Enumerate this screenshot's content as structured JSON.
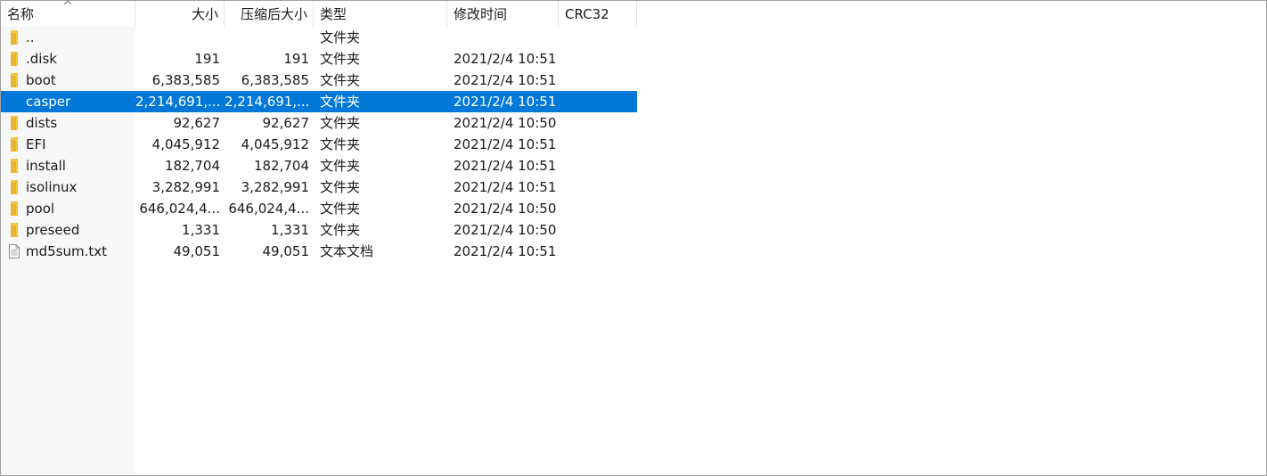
{
  "columns": {
    "name": "名称",
    "size": "大小",
    "packed_size": "压缩后大小",
    "type": "类型",
    "modified": "修改时间",
    "crc": "CRC32"
  },
  "files": [
    {
      "name": "..",
      "size": "",
      "packed_size": "",
      "type": "文件夹",
      "modified": "",
      "crc": "",
      "icon": "folder-icon"
    },
    {
      "name": ".disk",
      "size": "191",
      "packed_size": "191",
      "type": "文件夹",
      "modified": "2021/2/4 10:51",
      "crc": "",
      "icon": "folder-icon"
    },
    {
      "name": "boot",
      "size": "6,383,585",
      "packed_size": "6,383,585",
      "type": "文件夹",
      "modified": "2021/2/4 10:51",
      "crc": "",
      "icon": "folder-icon"
    },
    {
      "name": "casper",
      "size": "2,214,691,...",
      "packed_size": "2,214,691,...",
      "type": "文件夹",
      "modified": "2021/2/4 10:51",
      "crc": "",
      "icon": "folder-icon",
      "selected": true
    },
    {
      "name": "dists",
      "size": "92,627",
      "packed_size": "92,627",
      "type": "文件夹",
      "modified": "2021/2/4 10:50",
      "crc": "",
      "icon": "folder-icon"
    },
    {
      "name": "EFI",
      "size": "4,045,912",
      "packed_size": "4,045,912",
      "type": "文件夹",
      "modified": "2021/2/4 10:51",
      "crc": "",
      "icon": "folder-icon"
    },
    {
      "name": "install",
      "size": "182,704",
      "packed_size": "182,704",
      "type": "文件夹",
      "modified": "2021/2/4 10:51",
      "crc": "",
      "icon": "folder-icon"
    },
    {
      "name": "isolinux",
      "size": "3,282,991",
      "packed_size": "3,282,991",
      "type": "文件夹",
      "modified": "2021/2/4 10:51",
      "crc": "",
      "icon": "folder-icon"
    },
    {
      "name": "pool",
      "size": "646,024,4...",
      "packed_size": "646,024,4...",
      "type": "文件夹",
      "modified": "2021/2/4 10:50",
      "crc": "",
      "icon": "folder-icon"
    },
    {
      "name": "preseed",
      "size": "1,331",
      "packed_size": "1,331",
      "type": "文件夹",
      "modified": "2021/2/4 10:50",
      "crc": "",
      "icon": "folder-icon"
    },
    {
      "name": "md5sum.txt",
      "size": "49,051",
      "packed_size": "49,051",
      "type": "文本文档",
      "modified": "2021/2/4 10:51",
      "crc": "",
      "icon": "text-file-icon"
    }
  ],
  "colors": {
    "selection": "#0078d7",
    "folder": "#f4c544",
    "folder_selected": "#6e8fa8",
    "name_column_bg": "#f7f7f7"
  }
}
